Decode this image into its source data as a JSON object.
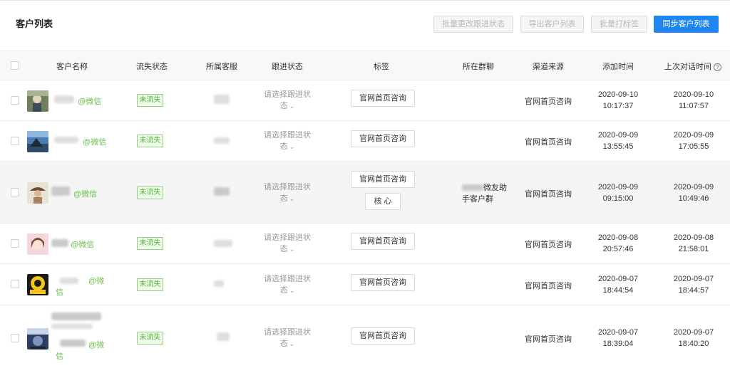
{
  "page_title": "客户列表",
  "toolbar": {
    "batch_status": "批量更改跟进状态",
    "export": "导出客户列表",
    "batch_tag": "批量打标签",
    "sync": "同步客户列表"
  },
  "columns": {
    "name": "客户名称",
    "lost": "流失状态",
    "agent": "所属客服",
    "follow": "跟进状态",
    "tags": "标签",
    "group": "所在群聊",
    "channel": "渠道来源",
    "added": "添加时间",
    "last": "上次对话时间",
    "help_icon": "?"
  },
  "rows": [
    {
      "wechat": "@微信",
      "lost": "未流失",
      "follow_line1": "请选择跟进状",
      "follow_line2": "态",
      "tag": "官网首页咨询",
      "channel": "官网首页咨询",
      "added_date": "2020-09-10",
      "added_time": "10:17:37",
      "last_date": "2020-09-10",
      "last_time": "11:07:57"
    },
    {
      "wechat": "@微信",
      "lost": "未流失",
      "follow_line1": "请选择跟进状",
      "follow_line2": "态",
      "tag": "官网首页咨询",
      "channel": "官网首页咨询",
      "added_date": "2020-09-09",
      "added_time": "13:55:45",
      "last_date": "2020-09-09",
      "last_time": "17:05:55"
    },
    {
      "wechat": "@微信",
      "lost": "未流失",
      "follow_line1": "请选择跟进状",
      "follow_line2": "态",
      "tag": "官网首页咨询",
      "tag2": "核 心",
      "group_line1": "微友助",
      "group_line2": "手客户群",
      "channel": "官网首页咨询",
      "added_date": "2020-09-09",
      "added_time": "09:15:00",
      "last_date": "2020-09-09",
      "last_time": "10:49:46"
    },
    {
      "wechat": "@微信",
      "lost": "未流失",
      "follow_line1": "请选择跟进状",
      "follow_line2": "态",
      "tag": "官网首页咨询",
      "channel": "官网首页咨询",
      "added_date": "2020-09-08",
      "added_time": "20:57:46",
      "last_date": "2020-09-08",
      "last_time": "21:58:01"
    },
    {
      "wechat_line1": "@微",
      "wechat_line2": "信",
      "lost": "未流失",
      "follow_line1": "请选择跟进状",
      "follow_line2": "态",
      "tag": "官网首页咨询",
      "channel": "官网首页咨询",
      "added_date": "2020-09-07",
      "added_time": "18:44:54",
      "last_date": "2020-09-07",
      "last_time": "18:44:57"
    },
    {
      "wechat_line1": "@微",
      "wechat_line2": "信",
      "lost": "未流失",
      "follow_line1": "请选择跟进状",
      "follow_line2": "态",
      "tag": "官网首页咨询",
      "channel": "官网首页咨询",
      "added_date": "2020-09-07",
      "added_time": "18:39:04",
      "last_date": "2020-09-07",
      "last_time": "18:40:20"
    }
  ],
  "colors": {
    "primary": "#1f86f0",
    "wechat_green": "#6cc04a",
    "lost_tag": "#52b43a"
  }
}
